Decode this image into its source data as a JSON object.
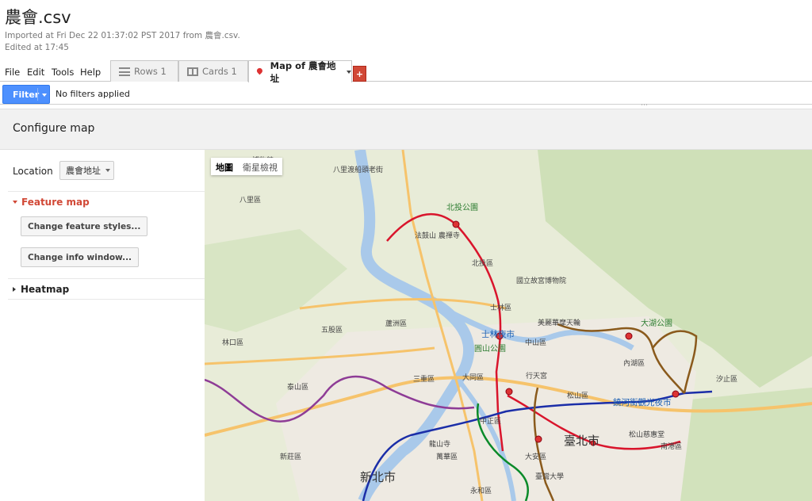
{
  "header": {
    "title": "農會.csv",
    "imported": "Imported at Fri Dec 22 01:37:02 PST 2017 from 農會.csv.",
    "edited": "Edited at 17:45"
  },
  "menu": {
    "file": "File",
    "edit": "Edit",
    "tools": "Tools",
    "help": "Help"
  },
  "tabs": {
    "rows": "Rows 1",
    "cards": "Cards 1",
    "map": "Map of 農會地址",
    "add": "+"
  },
  "filter": {
    "button": "Filter",
    "status": "No filters applied"
  },
  "config": {
    "title": "Configure map"
  },
  "sidebar": {
    "location_label": "Location",
    "location_value": "農會地址",
    "feature_map": "Feature map",
    "change_styles": "Change feature styles...",
    "change_info": "Change info window...",
    "heatmap": "Heatmap"
  },
  "map": {
    "toggle_map": "地圖",
    "toggle_satellite": "衛星檢視",
    "labels": {
      "bb": "博物館",
      "bali_ferry": "八里渡船頭老街",
      "bali": "八里區",
      "beitou_park": "北投公園",
      "fagu": "法鼓山 農禪寺",
      "beitou": "北投區",
      "museum": "國立故宮博物院",
      "shilin": "士林區",
      "shilin_nm": "士林夜市",
      "miramar": "美麗華摩天輪",
      "dahu": "大湖公園",
      "wugu": "五股區",
      "luzhou": "蘆洲區",
      "linkou": "林口區",
      "yuanshan": "圓山公園",
      "zhongshan": "中山區",
      "neihu": "內湖區",
      "xizhi": "汐止區",
      "sanchong": "三重區",
      "datong": "大同區",
      "xingtian": "行天宮",
      "taishan": "泰山區",
      "songshan": "松山區",
      "raohe": "饒河街觀光夜市",
      "zhongzheng": "中正區",
      "longshan": "龍山寺",
      "taipei": "臺北市",
      "ciyou": "松山慈惠堂",
      "nangang": "南港區",
      "xinzhuang": "新莊區",
      "wanhua": "萬華區",
      "daan": "大安區",
      "ntu": "臺灣大學",
      "newtaipei": "新北市",
      "yonghe": "永和區"
    }
  }
}
